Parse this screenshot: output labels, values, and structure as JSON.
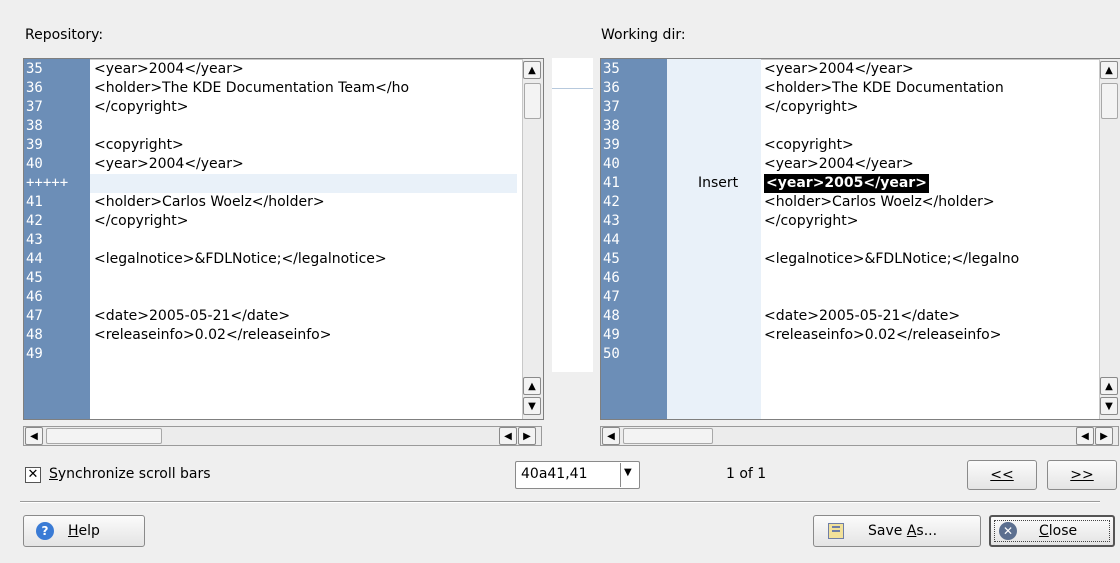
{
  "left_pane": {
    "label": "Repository:",
    "lines": [
      {
        "n": "35",
        "text": "<year>2004</year>"
      },
      {
        "n": "36",
        "text": "<holder>The KDE Documentation Team</ho"
      },
      {
        "n": "37",
        "text": "</copyright>"
      },
      {
        "n": "38",
        "text": ""
      },
      {
        "n": "39",
        "text": "<copyright>"
      },
      {
        "n": "40",
        "text": "<year>2004</year>"
      },
      {
        "n": "+++++",
        "text": ""
      },
      {
        "n": "41",
        "text": "<holder>Carlos Woelz</holder>"
      },
      {
        "n": "42",
        "text": "</copyright>"
      },
      {
        "n": "43",
        "text": ""
      },
      {
        "n": "44",
        "text": "<legalnotice>&FDLNotice;</legalnotice>"
      },
      {
        "n": "45",
        "text": ""
      },
      {
        "n": "46",
        "text": ""
      },
      {
        "n": "47",
        "text": "<date>2005-05-21</date>"
      },
      {
        "n": "48",
        "text": "<releaseinfo>0.02</releaseinfo>"
      },
      {
        "n": "49",
        "text": ""
      }
    ]
  },
  "right_pane": {
    "label": "Working dir:",
    "revision_label": "Insert",
    "lines": [
      {
        "n": "35",
        "text": "<year>2004</year>"
      },
      {
        "n": "36",
        "text": "<holder>The KDE Documentation"
      },
      {
        "n": "37",
        "text": "</copyright>"
      },
      {
        "n": "38",
        "text": ""
      },
      {
        "n": "39",
        "text": "<copyright>"
      },
      {
        "n": "40",
        "text": "<year>2004</year>"
      },
      {
        "n": "41",
        "text": "<year>2005</year>"
      },
      {
        "n": "42",
        "text": "<holder>Carlos Woelz</holder>"
      },
      {
        "n": "43",
        "text": "</copyright>"
      },
      {
        "n": "44",
        "text": ""
      },
      {
        "n": "45",
        "text": "<legalnotice>&FDLNotice;</legalno"
      },
      {
        "n": "46",
        "text": ""
      },
      {
        "n": "47",
        "text": ""
      },
      {
        "n": "48",
        "text": "<date>2005-05-21</date>"
      },
      {
        "n": "49",
        "text": "<releaseinfo>0.02</releaseinfo>"
      },
      {
        "n": "50",
        "text": ""
      }
    ]
  },
  "sync": {
    "checked": true,
    "mnemonic": "S",
    "label_rest": "ynchronize scroll bars"
  },
  "diff_select": {
    "value": "40a41,41"
  },
  "diff_count": "1 of 1",
  "nav": {
    "prev_label": "<<",
    "next_label": ">>"
  },
  "buttons": {
    "help": {
      "mnemonic": "H",
      "rest": "elp"
    },
    "save_as": {
      "pre": "Save ",
      "mnemonic": "A",
      "rest": "s..."
    },
    "close": {
      "mnemonic": "C",
      "rest": "lose"
    }
  },
  "colors": {
    "gutter": "#6c8eb7",
    "change_bg": "#e9f1f9",
    "selection": "#000000"
  }
}
